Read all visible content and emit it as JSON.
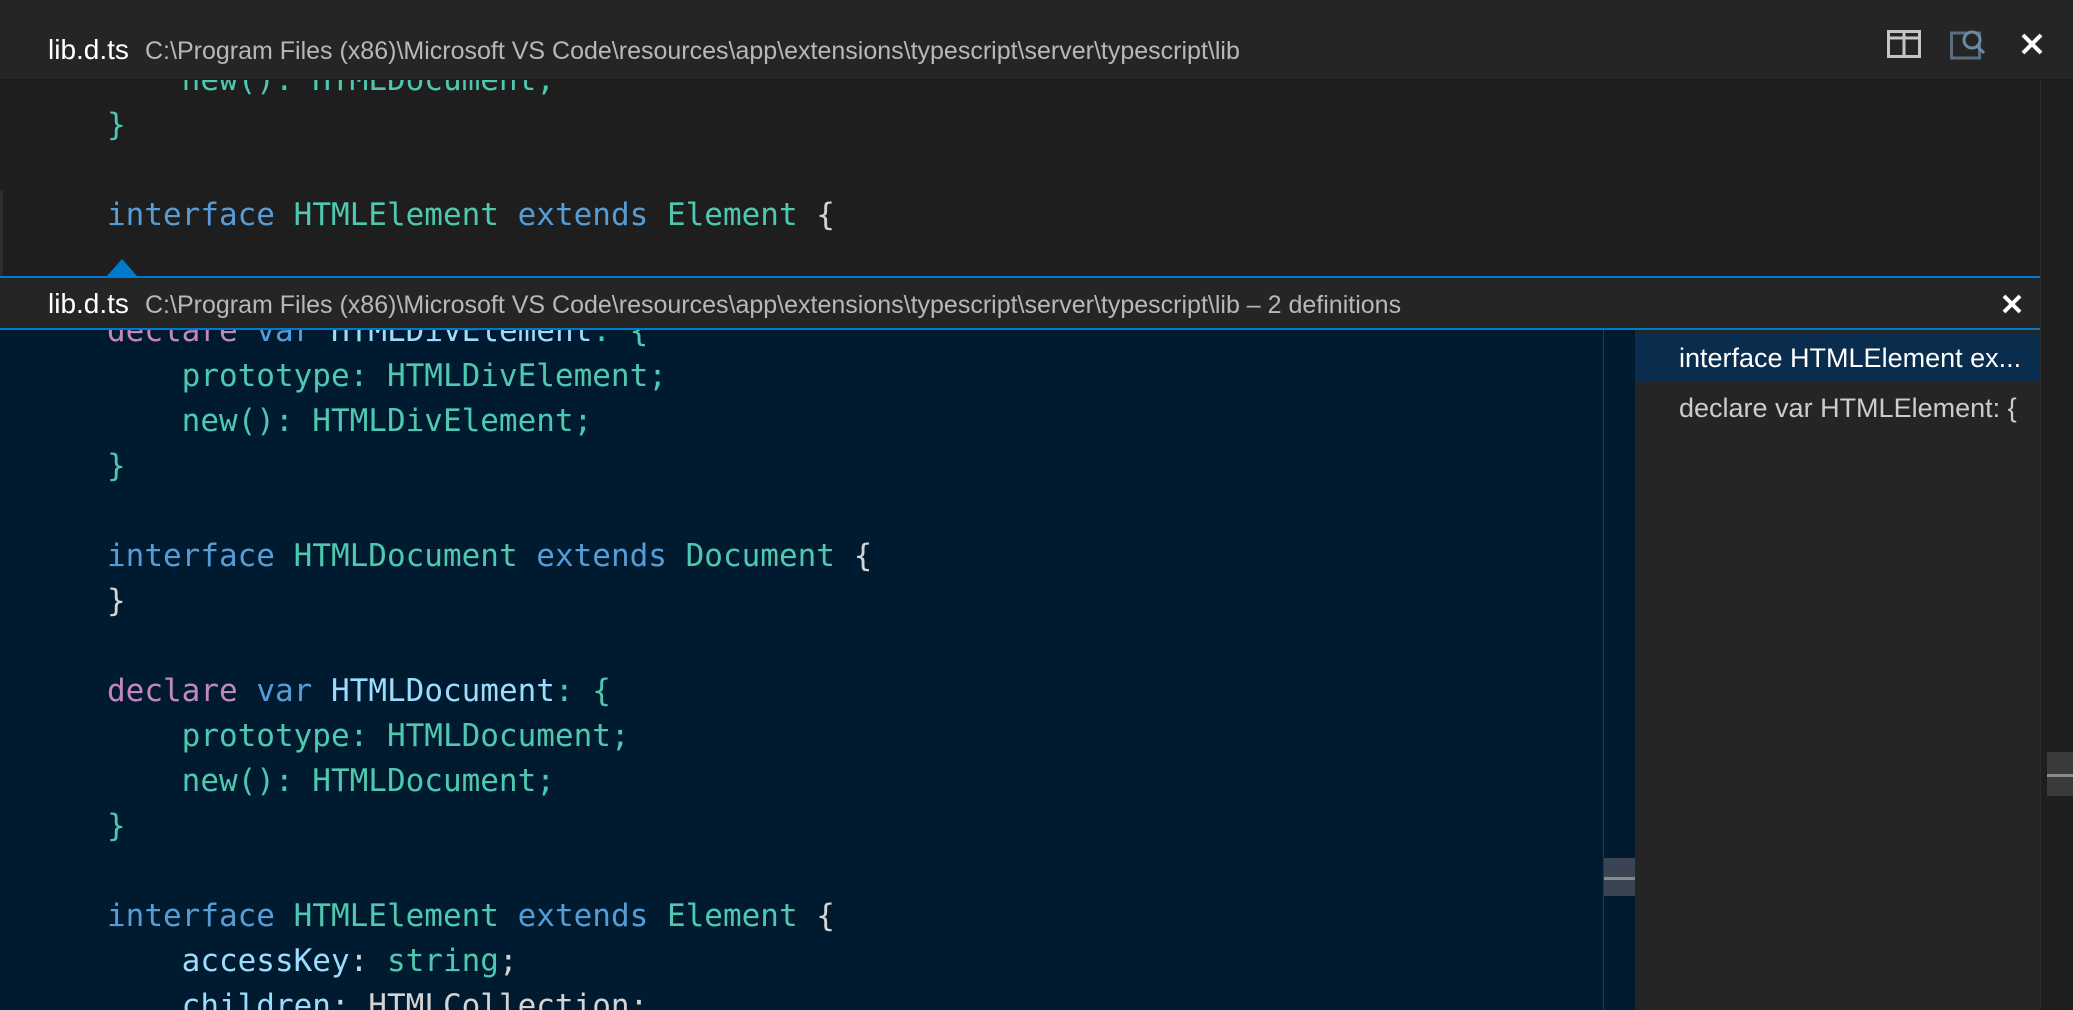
{
  "titlebar": {
    "filename": "lib.d.ts",
    "path": "C:\\Program Files (x86)\\Microsoft VS Code\\resources\\app\\extensions\\typescript\\server\\typescript\\lib",
    "actions": [
      {
        "name": "split-editor-icon"
      },
      {
        "name": "open-changes-icon"
      },
      {
        "name": "close-icon"
      }
    ]
  },
  "editor": {
    "lines": [
      [
        {
          "t": "    new(): HTMLDocument;",
          "c": "type"
        }
      ],
      [
        {
          "t": "}",
          "c": "type"
        }
      ],
      [],
      [
        {
          "t": "interface",
          "c": "kw"
        },
        {
          "t": " ",
          "c": "plain"
        },
        {
          "t": "HTMLElement",
          "c": "type"
        },
        {
          "t": " ",
          "c": "plain"
        },
        {
          "t": "extends",
          "c": "kw"
        },
        {
          "t": " ",
          "c": "plain"
        },
        {
          "t": "Element",
          "c": "type"
        },
        {
          "t": " {",
          "c": "punct"
        }
      ]
    ]
  },
  "peek": {
    "filename": "lib.d.ts",
    "meta": "C:\\Program Files (x86)\\Microsoft VS Code\\resources\\app\\extensions\\typescript\\server\\typescript\\lib – 2 definitions",
    "close_icon": "close-icon",
    "code": [
      [
        {
          "t": "declare",
          "c": "kw2"
        },
        {
          "t": " ",
          "c": "plain"
        },
        {
          "t": "var",
          "c": "kw"
        },
        {
          "t": " ",
          "c": "plain"
        },
        {
          "t": "HTMLDivElement",
          "c": "prop"
        },
        {
          "t": ": {",
          "c": "type"
        }
      ],
      [
        {
          "t": "    prototype: HTMLDivElement;",
          "c": "type"
        }
      ],
      [
        {
          "t": "    new(): HTMLDivElement;",
          "c": "type"
        }
      ],
      [
        {
          "t": "}",
          "c": "type"
        }
      ],
      [],
      [
        {
          "t": "interface",
          "c": "kw"
        },
        {
          "t": " ",
          "c": "plain"
        },
        {
          "t": "HTMLDocument",
          "c": "type"
        },
        {
          "t": " ",
          "c": "plain"
        },
        {
          "t": "extends",
          "c": "kw"
        },
        {
          "t": " ",
          "c": "plain"
        },
        {
          "t": "Document",
          "c": "type"
        },
        {
          "t": " {",
          "c": "punct"
        }
      ],
      [
        {
          "t": "}",
          "c": "punct"
        }
      ],
      [],
      [
        {
          "t": "declare",
          "c": "kw2"
        },
        {
          "t": " ",
          "c": "plain"
        },
        {
          "t": "var",
          "c": "kw"
        },
        {
          "t": " ",
          "c": "plain"
        },
        {
          "t": "HTMLDocument",
          "c": "prop"
        },
        {
          "t": ": {",
          "c": "type"
        }
      ],
      [
        {
          "t": "    prototype: HTMLDocument;",
          "c": "type"
        }
      ],
      [
        {
          "t": "    new(): HTMLDocument;",
          "c": "type"
        }
      ],
      [
        {
          "t": "}",
          "c": "type"
        }
      ],
      [],
      [
        {
          "t": "interface",
          "c": "kw"
        },
        {
          "t": " ",
          "c": "plain"
        },
        {
          "t": "HTMLElement",
          "c": "type"
        },
        {
          "t": " ",
          "c": "plain"
        },
        {
          "t": "extends",
          "c": "kw"
        },
        {
          "t": " ",
          "c": "plain"
        },
        {
          "t": "Element",
          "c": "type"
        },
        {
          "t": " {",
          "c": "punct"
        }
      ],
      [
        {
          "t": "    ",
          "c": "plain"
        },
        {
          "t": "accessKey",
          "c": "prop"
        },
        {
          "t": ": ",
          "c": "plain"
        },
        {
          "t": "string",
          "c": "type"
        },
        {
          "t": ";",
          "c": "plain"
        }
      ],
      [
        {
          "t": "    ",
          "c": "plain"
        },
        {
          "t": "children",
          "c": "prop"
        },
        {
          "t": ": ",
          "c": "plain"
        },
        {
          "t": "HTMLCollection",
          "c": "plain"
        },
        {
          "t": ";",
          "c": "plain"
        }
      ]
    ],
    "references": [
      {
        "label": "interface HTMLElement ex...",
        "selected": true
      },
      {
        "label": "declare var HTMLElement: {",
        "selected": false
      }
    ]
  }
}
